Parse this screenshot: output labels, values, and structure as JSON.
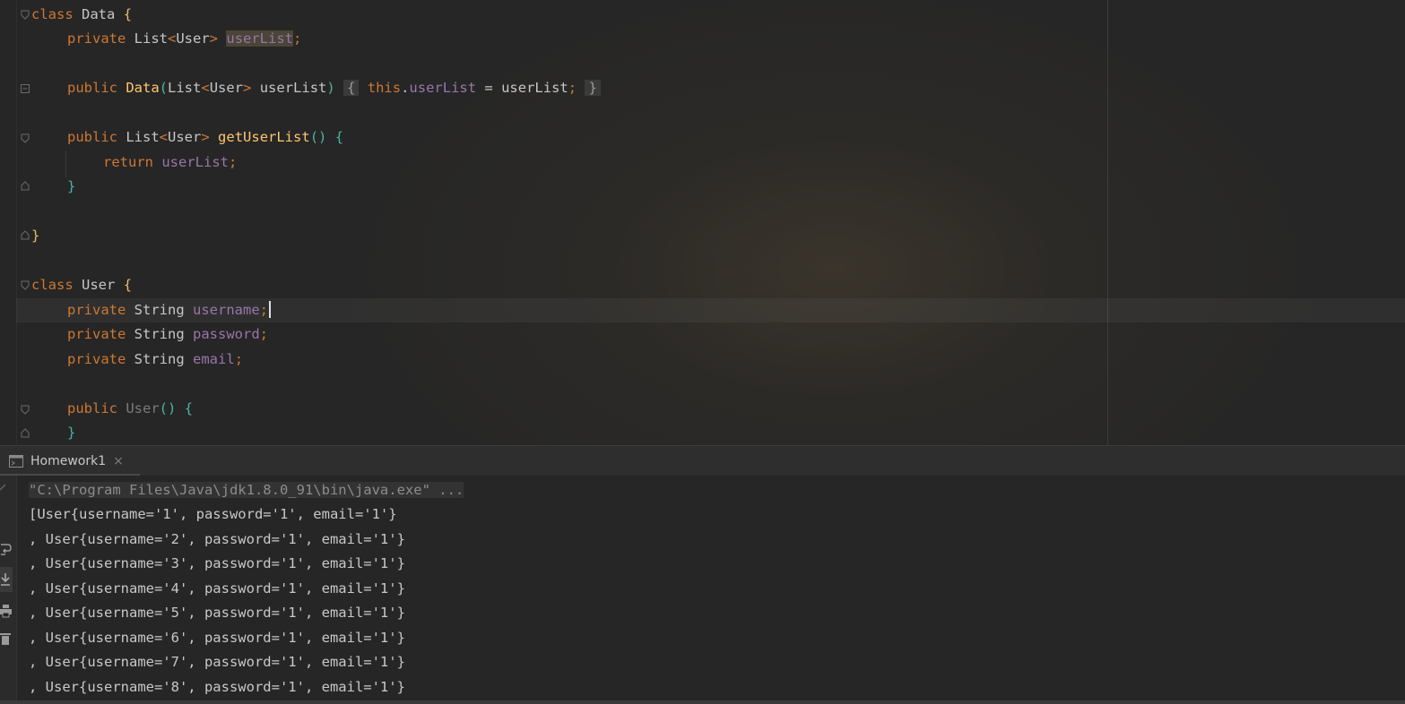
{
  "editor": {
    "lines": {
      "l1": {
        "kw": "class",
        "name": "Data",
        "brace": "{"
      },
      "l2": {
        "kw": "private",
        "type": "List",
        "lt": "<",
        "gen": "User",
        "gt": ">",
        "field": "userList",
        "semi": ";"
      },
      "l3": {
        "kw": "public",
        "name": "Data",
        "open": "(",
        "type": "List",
        "lt": "<",
        "gen": "User",
        "gt": ">",
        "param": "userList",
        "close": ")",
        "lbrace": "{",
        "this": "this",
        "dot": ".",
        "field": "userList",
        "eq": "=",
        "rhs": "userList",
        "semi": ";",
        "rbrace": "}"
      },
      "l4": {
        "kw": "public",
        "type": "List",
        "lt": "<",
        "gen": "User",
        "gt": ">",
        "method": "getUserList",
        "parens": "()",
        "brace": "{"
      },
      "l5": {
        "kw": "return",
        "field": "userList",
        "semi": ";"
      },
      "l6": {
        "brace": "}"
      },
      "l7": {
        "brace": "}"
      },
      "l8": {
        "kw": "class",
        "name": "User",
        "brace": "{"
      },
      "l9": {
        "kw": "private",
        "type": "String",
        "field": "username",
        "semi": ";"
      },
      "l10": {
        "kw": "private",
        "type": "String",
        "field": "password",
        "semi": ";"
      },
      "l11": {
        "kw": "private",
        "type": "String",
        "field": "email",
        "semi": ";"
      },
      "l12": {
        "kw": "public",
        "name": "User",
        "parens": "()",
        "brace": "{"
      },
      "l13": {
        "brace": "}"
      }
    }
  },
  "run": {
    "tab_label": "Homework1",
    "close_glyph": "×",
    "console": [
      "\"C:\\Program Files\\Java\\jdk1.8.0_91\\bin\\java.exe\" ...",
      "[User{username='1', password='1', email='1'}",
      ", User{username='2', password='1', email='1'}",
      ", User{username='3', password='1', email='1'}",
      ", User{username='4', password='1', email='1'}",
      ", User{username='5', password='1', email='1'}",
      ", User{username='6', password='1', email='1'}",
      ", User{username='7', password='1', email='1'}",
      ", User{username='8', password='1', email='1'}"
    ]
  },
  "icons": [
    "fold-open-icon",
    "fold-close-icon",
    "console-tab-icon",
    "soft-wrap-icon",
    "scroll-to-end-icon",
    "print-icon",
    "trash-icon"
  ]
}
